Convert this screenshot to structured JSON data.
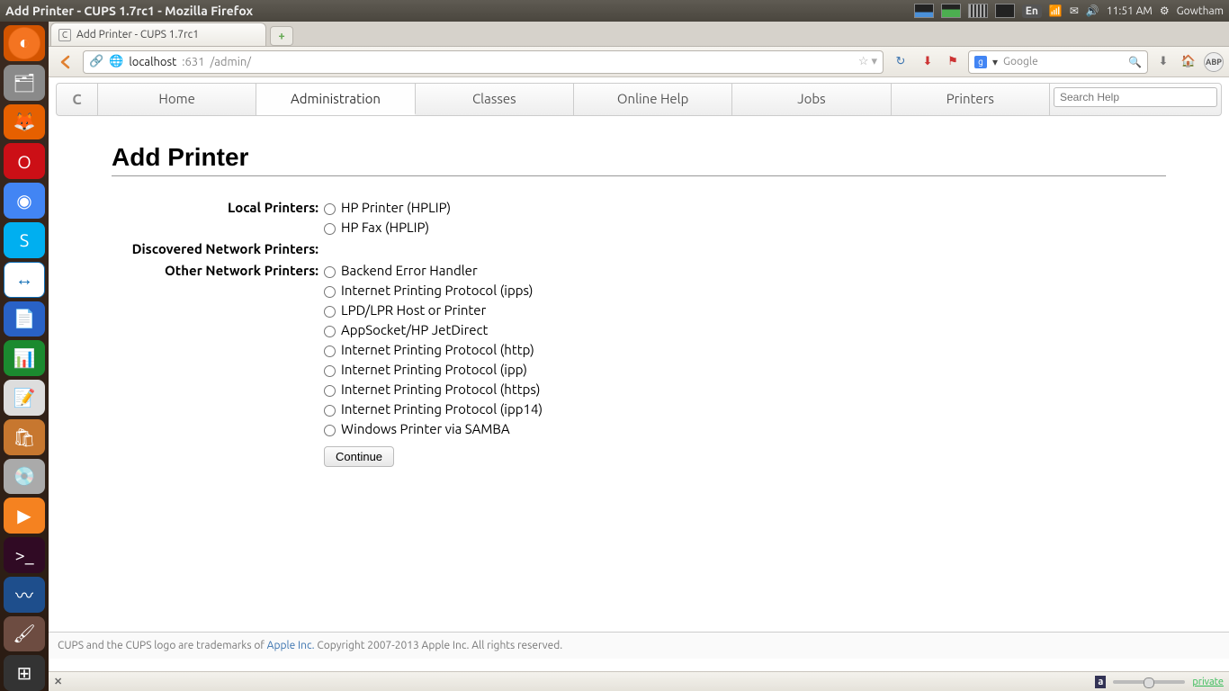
{
  "os": {
    "window_title": "Add Printer - CUPS 1.7rc1 - Mozilla Firefox",
    "lang": "En",
    "time": "11:51 AM",
    "user": "Gowtham"
  },
  "browser": {
    "tab_title": "Add Printer - CUPS 1.7rc1",
    "url_host": "localhost",
    "url_port": ":631",
    "url_path": "/admin/",
    "search_engine": "Google",
    "search_placeholder": "Google",
    "addonbar_private": "private"
  },
  "cups_nav": {
    "tabs": [
      "Home",
      "Administration",
      "Classes",
      "Online Help",
      "Jobs",
      "Printers"
    ],
    "active_index": 1,
    "search_placeholder": "Search Help"
  },
  "page": {
    "heading": "Add Printer",
    "sections": {
      "local_label": "Local Printers:",
      "local": [
        "HP Printer (HPLIP)",
        "HP Fax (HPLIP)"
      ],
      "discovered_label": "Discovered Network Printers:",
      "discovered": [],
      "other_label": "Other Network Printers:",
      "other": [
        "Backend Error Handler",
        "Internet Printing Protocol (ipps)",
        "LPD/LPR Host or Printer",
        "AppSocket/HP JetDirect",
        "Internet Printing Protocol (http)",
        "Internet Printing Protocol (ipp)",
        "Internet Printing Protocol (https)",
        "Internet Printing Protocol (ipp14)",
        "Windows Printer via SAMBA"
      ]
    },
    "continue_label": "Continue"
  },
  "footer": {
    "pre": "CUPS and the CUPS logo are trademarks of ",
    "link": "Apple Inc.",
    "post": " Copyright 2007-2013 Apple Inc. All rights reserved."
  }
}
